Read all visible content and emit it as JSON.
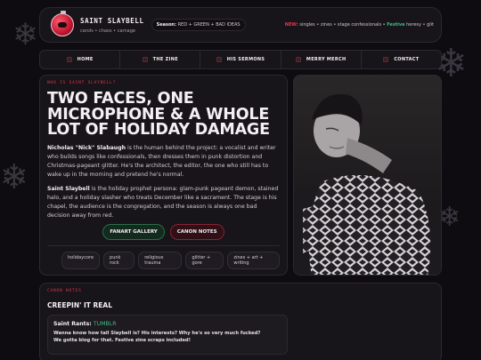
{
  "header": {
    "title": "SAINT SLAYBELL",
    "subtitle": "carols • chaos • carnage",
    "season_label": "Season:",
    "season_value": "RED + GREEN + BAD IDEAS",
    "ticker_new": "NEW:",
    "ticker_mid": "singles • zines • stage confessionals •",
    "ticker_festive": "Festive",
    "ticker_end": "heresy • glit"
  },
  "nav": {
    "items": [
      "HOME",
      "THE ZINE",
      "HIS SERMONS",
      "MERRY MERCH",
      "CONTACT"
    ]
  },
  "main": {
    "eyebrow": "WHO IS SAINT SLAYBELL?",
    "headline": "TWO FACES, ONE MICROPHONE & A WHOLE LOT OF HOLIDAY DAMAGE",
    "para1_name": "Nicholas \"Nick\" Slabaugh",
    "para1_text": " is the human behind the project: a vocalist and writer who builds songs like confessionals, then dresses them in punk distortion and Christmas-pageant glitter. He's the architect, the editor, the one who still has to wake up in the morning and pretend he's normal.",
    "para2_name": "Saint Slaybell",
    "para2_text": " is the holiday prophet persona: glam-punk pageant demon, stained halo, and a holiday slasher who treats December like a sacrament. The stage is his chapel, the audience is the congregation, and the season is always one bad decision away from red.",
    "btn_gallery": "FANART GALLERY",
    "btn_canon": "CANON NOTES",
    "tags": [
      "holidaycore",
      "punk rock",
      "religious trauma",
      "glitter + gore",
      "zines + art + writing"
    ]
  },
  "bottom": {
    "eyebrow": "CANON NOTES",
    "title": "CREEPIN' IT REAL",
    "quote_head": "Saint Rants:",
    "quote_tumblr": "TUMBLR",
    "quote_line1": "Wanna know how tall Slaybell is? His interests? Why he's so very much fucked?",
    "quote_line2": "We gotta blog for that. Festive zine scraps included!"
  },
  "colors": {
    "accent_red": "#e0394e",
    "accent_green": "#3fbf7f",
    "background": "#0e0c10",
    "panel": "#17141a"
  },
  "icons": {
    "logo": "christmas-ornament-icon",
    "decor": "snowflake-icon"
  }
}
